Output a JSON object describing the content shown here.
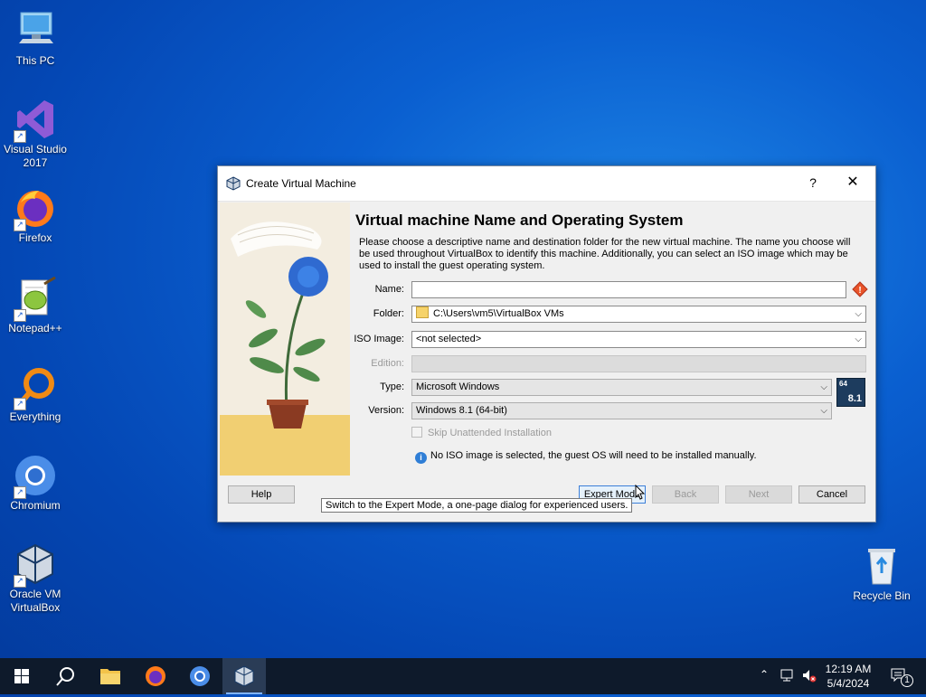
{
  "desktop": {
    "icons": [
      {
        "label": "This PC"
      },
      {
        "label": "Visual Studio 2017"
      },
      {
        "label": "Firefox"
      },
      {
        "label": "Notepad++"
      },
      {
        "label": "Everything"
      },
      {
        "label": "Chromium"
      },
      {
        "label": "Oracle VM VirtualBox"
      },
      {
        "label": "Recycle Bin"
      }
    ]
  },
  "dialog": {
    "title": "Create Virtual Machine",
    "help_glyph": "?",
    "close_glyph": "✕",
    "heading": "Virtual machine Name and Operating System",
    "description": "Please choose a descriptive name and destination folder for the new virtual machine. The name you choose will be used throughout VirtualBox to identify this machine. Additionally, you can select an ISO image which may be used to install the guest operating system.",
    "fields": {
      "name": {
        "label": "Name:",
        "value": ""
      },
      "folder": {
        "label": "Folder:",
        "value": "C:\\Users\\vm5\\VirtualBox VMs"
      },
      "iso": {
        "label": "ISO Image:",
        "value": "<not selected>"
      },
      "edition": {
        "label": "Edition:",
        "value": ""
      },
      "type": {
        "label": "Type:",
        "value": "Microsoft Windows"
      },
      "version": {
        "label": "Version:",
        "value": "Windows 8.1 (64-bit)"
      }
    },
    "os_badge": {
      "bits": "64",
      "version": "8.1"
    },
    "skip_unattended": {
      "label": "Skip Unattended Installation",
      "checked": false
    },
    "info_message": "No ISO image is selected, the guest OS will need to be installed manually.",
    "buttons": {
      "help": "Help",
      "expert": "Expert Mode",
      "back": "Back",
      "next": "Next",
      "cancel": "Cancel"
    },
    "tooltip": "Switch to the Expert Mode, a one-page dialog for experienced users."
  },
  "taskbar": {
    "time": "12:19 AM",
    "date": "5/4/2024",
    "notification_count": "1"
  },
  "colors": {
    "desktop": "#0a5fd0",
    "taskbar": "#0e1a2b",
    "accent": "#3c7fd8"
  }
}
